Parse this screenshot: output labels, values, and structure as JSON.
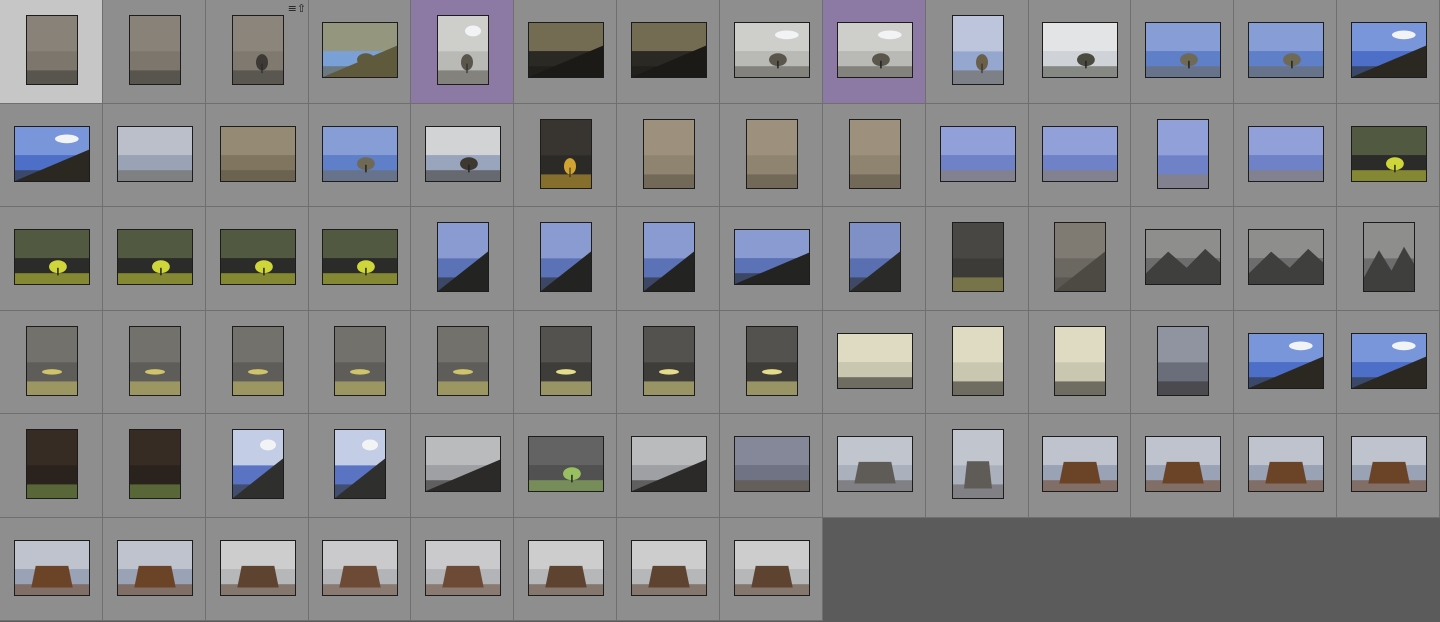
{
  "app": {
    "view": "grid",
    "cell_color": "#8e8e8e",
    "selected_cell_color": "#c6c6c6",
    "highlight_cell_color": "#8c7aa4",
    "empty_area_color": "#5b5b5b"
  },
  "badges": {
    "stack_icon": "≡⇧"
  },
  "thumbnails": [
    {
      "scene": "plain-gray",
      "orient": "portrait",
      "state": "selected"
    },
    {
      "scene": "plain-gray",
      "orient": "portrait"
    },
    {
      "scene": "plain-gray-tree",
      "orient": "portrait",
      "badge": "stack"
    },
    {
      "scene": "hill-tree",
      "orient": "landscape"
    },
    {
      "scene": "cloud-tree",
      "orient": "portrait",
      "state": "highlighted"
    },
    {
      "scene": "dark-hill",
      "orient": "landscape"
    },
    {
      "scene": "dark-hill",
      "orient": "landscape"
    },
    {
      "scene": "cloud-tree",
      "orient": "landscape"
    },
    {
      "scene": "cloud-tree",
      "orient": "landscape",
      "state": "highlighted"
    },
    {
      "scene": "bare-tree",
      "orient": "portrait"
    },
    {
      "scene": "big-tree",
      "orient": "landscape"
    },
    {
      "scene": "blue-tree",
      "orient": "landscape"
    },
    {
      "scene": "blue-tree",
      "orient": "landscape"
    },
    {
      "scene": "blue-cloud-hill",
      "orient": "landscape"
    },
    {
      "scene": "blue-cloud-hill",
      "orient": "landscape"
    },
    {
      "scene": "pale-plain",
      "orient": "landscape"
    },
    {
      "scene": "brush",
      "orient": "landscape"
    },
    {
      "scene": "blue-tree",
      "orient": "landscape"
    },
    {
      "scene": "dark-plain-tree",
      "orient": "landscape"
    },
    {
      "scene": "yellow-bush",
      "orient": "portrait"
    },
    {
      "scene": "rock-field",
      "orient": "portrait"
    },
    {
      "scene": "rock-field",
      "orient": "portrait"
    },
    {
      "scene": "rock-field",
      "orient": "portrait"
    },
    {
      "scene": "blue-field",
      "orient": "landscape"
    },
    {
      "scene": "blue-field",
      "orient": "landscape"
    },
    {
      "scene": "blue-field",
      "orient": "portrait"
    },
    {
      "scene": "blue-field",
      "orient": "landscape"
    },
    {
      "scene": "yellow-tree",
      "orient": "landscape"
    },
    {
      "scene": "yellow-tree",
      "orient": "landscape"
    },
    {
      "scene": "yellow-tree",
      "orient": "landscape"
    },
    {
      "scene": "yellow-tree",
      "orient": "landscape"
    },
    {
      "scene": "yellow-tree",
      "orient": "landscape"
    },
    {
      "scene": "blue-slope",
      "orient": "portrait"
    },
    {
      "scene": "blue-slope",
      "orient": "portrait"
    },
    {
      "scene": "blue-slope",
      "orient": "portrait"
    },
    {
      "scene": "blue-slope",
      "orient": "landscape"
    },
    {
      "scene": "blue-slope-pole",
      "orient": "portrait"
    },
    {
      "scene": "dark-ground",
      "orient": "portrait"
    },
    {
      "scene": "gray-slope",
      "orient": "portrait"
    },
    {
      "scene": "gray-mountains",
      "orient": "landscape"
    },
    {
      "scene": "gray-mountains",
      "orient": "landscape"
    },
    {
      "scene": "gray-mountains",
      "orient": "portrait"
    },
    {
      "scene": "gray-reflect",
      "orient": "portrait"
    },
    {
      "scene": "gray-reflect",
      "orient": "portrait"
    },
    {
      "scene": "gray-reflect",
      "orient": "portrait"
    },
    {
      "scene": "gray-reflect",
      "orient": "portrait"
    },
    {
      "scene": "gray-reflect",
      "orient": "portrait"
    },
    {
      "scene": "dark-reflect",
      "orient": "portrait"
    },
    {
      "scene": "dark-reflect",
      "orient": "portrait"
    },
    {
      "scene": "dark-reflect",
      "orient": "portrait"
    },
    {
      "scene": "dusk-field",
      "orient": "landscape"
    },
    {
      "scene": "dusk-field",
      "orient": "portrait"
    },
    {
      "scene": "dusk-field",
      "orient": "portrait"
    },
    {
      "scene": "storm",
      "orient": "portrait"
    },
    {
      "scene": "blue-cloud-hill",
      "orient": "landscape"
    },
    {
      "scene": "blue-cloud-hill",
      "orient": "landscape"
    },
    {
      "scene": "forest-dark",
      "orient": "portrait"
    },
    {
      "scene": "forest-dark",
      "orient": "portrait"
    },
    {
      "scene": "blue-cloud-slope",
      "orient": "portrait"
    },
    {
      "scene": "blue-cloud-slope",
      "orient": "portrait"
    },
    {
      "scene": "gray-sky-slope",
      "orient": "landscape"
    },
    {
      "scene": "sapling",
      "orient": "landscape"
    },
    {
      "scene": "gray-sky-slope",
      "orient": "landscape"
    },
    {
      "scene": "dusk-plain",
      "orient": "landscape"
    },
    {
      "scene": "butte-gray",
      "orient": "landscape"
    },
    {
      "scene": "butte-gray",
      "orient": "portrait"
    },
    {
      "scene": "butte-red",
      "orient": "landscape"
    },
    {
      "scene": "butte-red",
      "orient": "landscape"
    },
    {
      "scene": "butte-red",
      "orient": "landscape"
    },
    {
      "scene": "butte-red",
      "orient": "landscape"
    },
    {
      "scene": "butte-red",
      "orient": "landscape"
    },
    {
      "scene": "butte-red",
      "orient": "landscape"
    },
    {
      "scene": "rocks-pale",
      "orient": "landscape"
    },
    {
      "scene": "spire",
      "orient": "landscape"
    },
    {
      "scene": "spire",
      "orient": "landscape"
    },
    {
      "scene": "rocks-pale",
      "orient": "landscape"
    },
    {
      "scene": "rocks-pale",
      "orient": "landscape"
    },
    {
      "scene": "rocks-pale",
      "orient": "landscape"
    }
  ]
}
